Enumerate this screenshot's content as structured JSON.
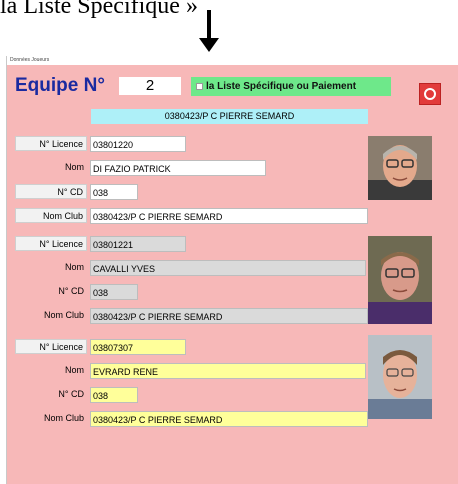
{
  "caption": "la Liste Spécifique »",
  "window_title": "Données Joueurs",
  "header": {
    "equipe_label": "Equipe N°",
    "team_number": "2",
    "toggle_label": "la Liste Spécifique ou Paiement"
  },
  "club_header": "0380423/P C PIERRE SEMARD",
  "labels": {
    "licence": "N° Licence",
    "nom": "Nom",
    "cd": "N° CD",
    "club": "Nom Club"
  },
  "players": [
    {
      "licence": "03801220",
      "nom": "DI FAZIO PATRICK",
      "cd": "038",
      "club": "0380423/P C PIERRE SEMARD"
    },
    {
      "licence": "03801221",
      "nom": "CAVALLI YVES",
      "cd": "038",
      "club": "0380423/P C PIERRE SEMARD"
    },
    {
      "licence": "03807307",
      "nom": "EVRARD RENE",
      "cd": "038",
      "club": "0380423/P C PIERRE SEMARD"
    }
  ],
  "colors": {
    "background": "#f7b8b8",
    "title_text": "#1a2aa0",
    "toggle": "#6ee88a",
    "club_header": "#aef0f8",
    "player2_fields": "#dadada",
    "player3_fields": "#ffff9a",
    "close_button": "#e23b3b"
  }
}
